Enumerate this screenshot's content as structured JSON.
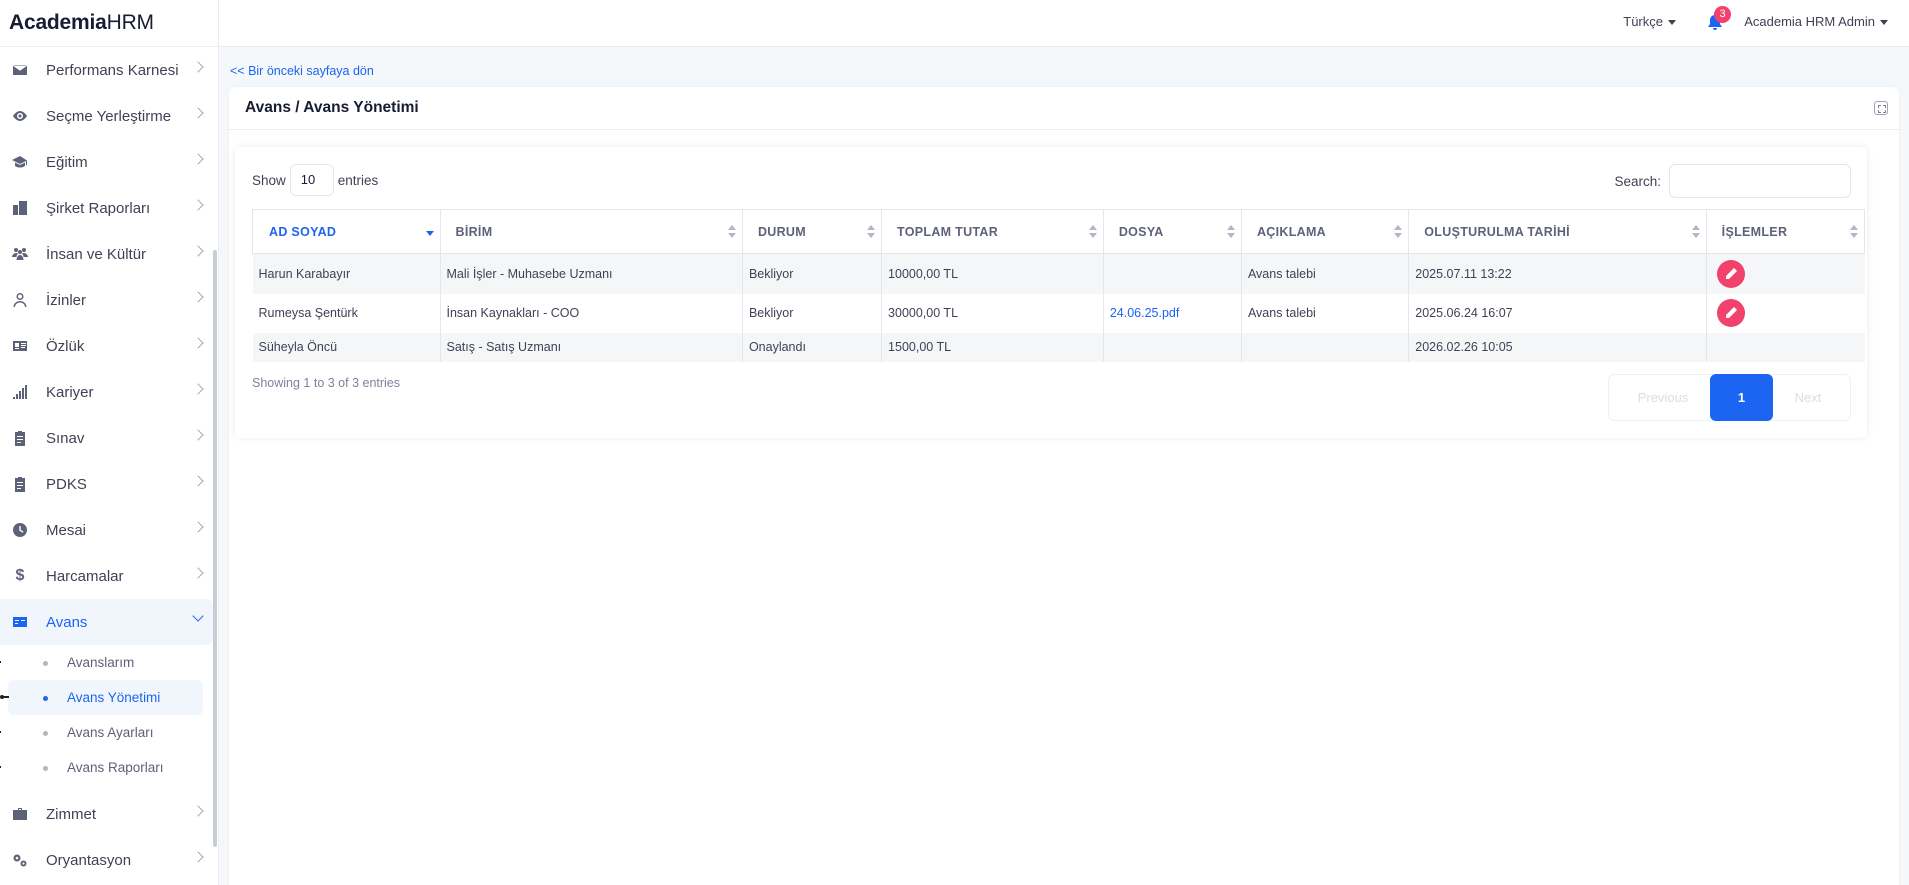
{
  "brand": {
    "bold": "Academia",
    "light": "HRM"
  },
  "header": {
    "language": "Türkçe",
    "notification_count": "3",
    "user": "Academia HRM Admin"
  },
  "sidebar": {
    "items": [
      {
        "label": "Performans Karnesi",
        "icon": "envelope-icon"
      },
      {
        "label": "Seçme Yerleştirme",
        "icon": "eye-icon"
      },
      {
        "label": "Eğitim",
        "icon": "graduation-cap-icon"
      },
      {
        "label": "Şirket Raporları",
        "icon": "buildings-icon"
      },
      {
        "label": "İnsan ve Kültür",
        "icon": "people-icon"
      },
      {
        "label": "İzinler",
        "icon": "user-icon"
      },
      {
        "label": "Özlük",
        "icon": "id-card-icon"
      },
      {
        "label": "Kariyer",
        "icon": "signal-bars-icon"
      },
      {
        "label": "Sınav",
        "icon": "clipboard-icon"
      },
      {
        "label": "PDKS",
        "icon": "clipboard-icon"
      },
      {
        "label": "Mesai",
        "icon": "clock-icon"
      },
      {
        "label": "Harcamalar",
        "icon": "dollar-icon"
      },
      {
        "label": "Avans",
        "icon": "money-card-icon"
      },
      {
        "label": "Zimmet",
        "icon": "briefcase-icon"
      },
      {
        "label": "Oryantasyon",
        "icon": "gears-icon"
      }
    ],
    "avans_sub": [
      {
        "label": "Avanslarım"
      },
      {
        "label": "Avans Yönetimi"
      },
      {
        "label": "Avans Ayarları"
      },
      {
        "label": "Avans Raporları"
      }
    ]
  },
  "main": {
    "back_link": "<< Bir önceki sayfaya dön",
    "title": "Avans / Avans Yönetimi",
    "show_label": "Show",
    "page_length": "10",
    "entries_label": "entries",
    "search_label": "Search:",
    "search_value": "",
    "columns": [
      "AD SOYAD",
      "BİRİM",
      "DURUM",
      "TOPLAM TUTAR",
      "DOSYA",
      "AÇIKLAMA",
      "OLUŞTURULMA TARİHİ",
      "İŞLEMLER"
    ],
    "rows": [
      {
        "name": "Harun Karabayır",
        "unit": "Mali İşler - Muhasebe Uzmanı",
        "status": "Bekliyor",
        "total": "10000,00 TL",
        "file": "",
        "desc": "Avans talebi",
        "created": "2025.07.11 13:22"
      },
      {
        "name": "Rumeysa Şentürk",
        "unit": "İnsan Kaynakları - COO",
        "status": "Bekliyor",
        "total": "30000,00 TL",
        "file": "24.06.25.pdf",
        "desc": "Avans talebi",
        "created": "2025.06.24 16:07"
      },
      {
        "name": "Süheyla Öncü",
        "unit": "Satış - Satış Uzmanı",
        "status": "Onaylandı",
        "total": "1500,00 TL",
        "file": "",
        "desc": "",
        "created": "2026.02.26 10:05"
      }
    ],
    "info": "Showing 1 to 3 of 3 entries",
    "pagination": {
      "previous": "Previous",
      "current": "1",
      "next": "Next"
    }
  },
  "colors": {
    "accent": "#1c64f2",
    "danger": "#f1416c"
  }
}
